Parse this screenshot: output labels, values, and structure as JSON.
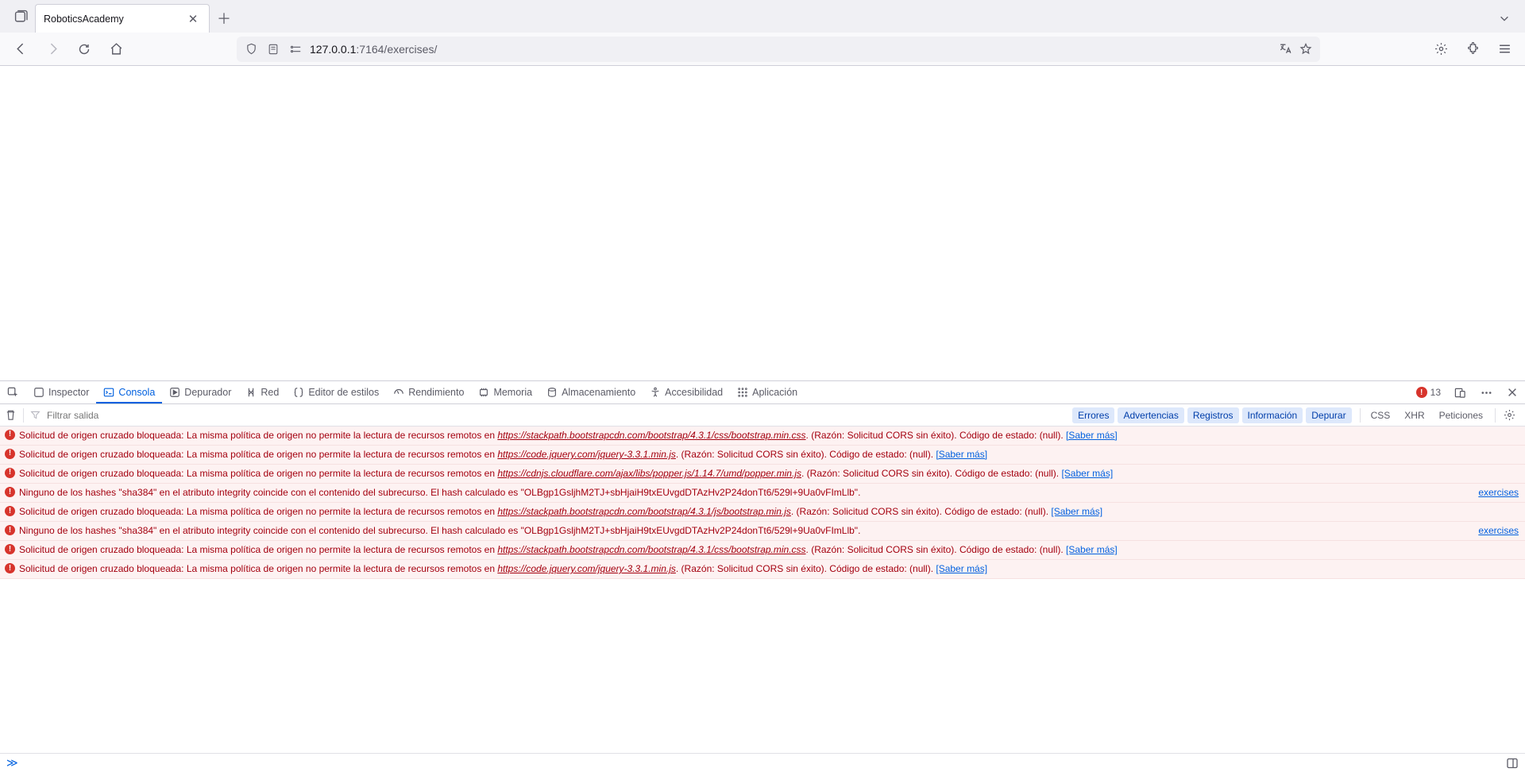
{
  "browser": {
    "tab_title": "RoboticsAcademy",
    "url_host": "127.0.0.1",
    "url_path": ":7164/exercises/"
  },
  "devtools": {
    "tabs": {
      "inspector": "Inspector",
      "console": "Consola",
      "debugger": "Depurador",
      "network": "Red",
      "style_editor": "Editor de estilos",
      "performance": "Rendimiento",
      "memory": "Memoria",
      "storage": "Almacenamiento",
      "accessibility": "Accesibilidad",
      "application": "Aplicación"
    },
    "error_count": "13",
    "filter_placeholder": "Filtrar salida",
    "filters": {
      "errores": "Errores",
      "advertencias": "Advertencias",
      "registros": "Registros",
      "informacion": "Información",
      "depurar": "Depurar",
      "css": "CSS",
      "xhr": "XHR",
      "peticiones": "Peticiones"
    }
  },
  "strings": {
    "cors_prefix": "Solicitud de origen cruzado bloqueada: La misma política de origen no permite la lectura de recursos remotos en ",
    "cors_suffix": ". (Razón: Solicitud CORS sin éxito). Código de estado: (null). ",
    "learn_more": "[Saber más]",
    "hash_msg": "Ninguno de los hashes \"sha384\" en el atributo integrity coincide con el contenido del subrecurso. El hash calculado es \"OLBgp1GsljhM2TJ+sbHjaiH9txEUvgdDTAzHv2P24donTt6/529l+9Ua0vFImLlb\".",
    "src_exercises": "exercises"
  },
  "messages": [
    {
      "type": "cors",
      "url": "https://stackpath.bootstrapcdn.com/bootstrap/4.3.1/css/bootstrap.min.css"
    },
    {
      "type": "cors",
      "url": "https://code.jquery.com/jquery-3.3.1.min.js"
    },
    {
      "type": "cors",
      "url": "https://cdnjs.cloudflare.com/ajax/libs/popper.js/1.14.7/umd/popper.min.js"
    },
    {
      "type": "hash",
      "src": "exercises"
    },
    {
      "type": "cors",
      "url": "https://stackpath.bootstrapcdn.com/bootstrap/4.3.1/js/bootstrap.min.js"
    },
    {
      "type": "hash",
      "src": "exercises"
    },
    {
      "type": "cors",
      "url": "https://stackpath.bootstrapcdn.com/bootstrap/4.3.1/css/bootstrap.min.css"
    },
    {
      "type": "cors",
      "url": "https://code.jquery.com/jquery-3.3.1.min.js"
    }
  ]
}
